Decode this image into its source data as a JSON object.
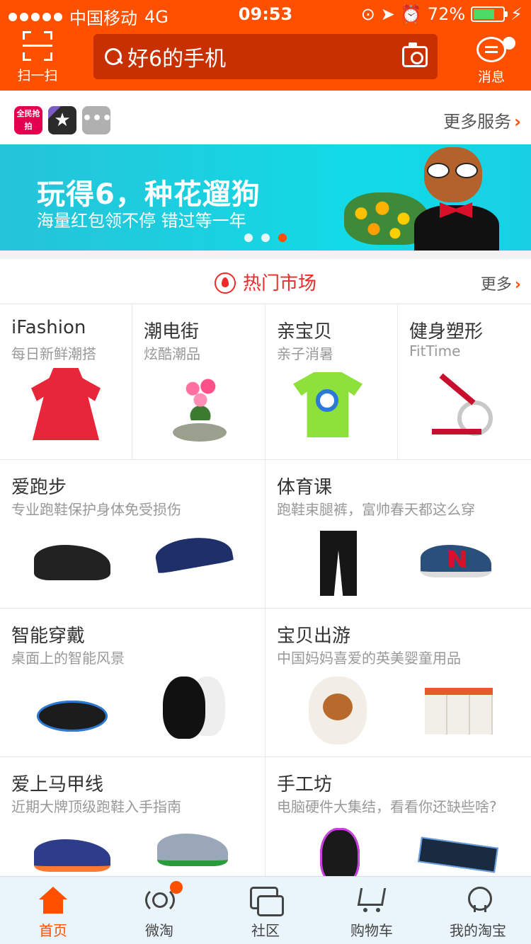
{
  "status_bar": {
    "carrier": "中国移动",
    "network": "4G",
    "time": "09:53",
    "battery": "72%",
    "battery_level": 0.72
  },
  "header": {
    "scan_label": "扫一扫",
    "search_placeholder": "好6的手机",
    "message_label": "消息"
  },
  "services": {
    "icons": [
      "qiangpai-icon",
      "star-app-icon",
      "more-dots-icon"
    ],
    "qiangpai_text": "全民抢拍",
    "more_label": "更多服务"
  },
  "banner": {
    "title": "玩得6，种花遛狗",
    "subtitle": "海量红包领不停 错过等一年",
    "page_count": 3,
    "active_page": 3
  },
  "hot_market": {
    "title": "热门市场",
    "more_label": "更多"
  },
  "row1": [
    {
      "title": "iFashion",
      "subtitle": "每日新鲜潮搭"
    },
    {
      "title": "潮电街",
      "subtitle": "炫酷潮品"
    },
    {
      "title": "亲宝贝",
      "subtitle": "亲子消暑"
    },
    {
      "title": "健身塑形",
      "subtitle": "FitTime"
    }
  ],
  "row2": [
    {
      "title": "爱跑步",
      "subtitle": "专业跑鞋保护身体免受损伤"
    },
    {
      "title": "体育课",
      "subtitle": "跑鞋束腿裤，富帅春天都这么穿"
    }
  ],
  "row3": [
    {
      "title": "智能穿戴",
      "subtitle": "桌面上的智能风景"
    },
    {
      "title": "宝贝出游",
      "subtitle": "中国妈妈喜爱的英美婴童用品"
    }
  ],
  "row4": [
    {
      "title": "爱上马甲线",
      "subtitle": "近期大牌顶级跑鞋入手指南"
    },
    {
      "title": "手工坊",
      "subtitle": "电脑硬件大集结，看看你还缺些啥?"
    }
  ],
  "tabbar": [
    {
      "label": "首页",
      "icon": "home-icon",
      "active": true
    },
    {
      "label": "微淘",
      "icon": "weitao-icon",
      "badge": true
    },
    {
      "label": "社区",
      "icon": "community-icon"
    },
    {
      "label": "购物车",
      "icon": "cart-icon"
    },
    {
      "label": "我的淘宝",
      "icon": "profile-icon"
    }
  ],
  "colors": {
    "brand": "#ff5000",
    "hot_red": "#ee2a2a",
    "banner_bg": "#12dbe7"
  }
}
